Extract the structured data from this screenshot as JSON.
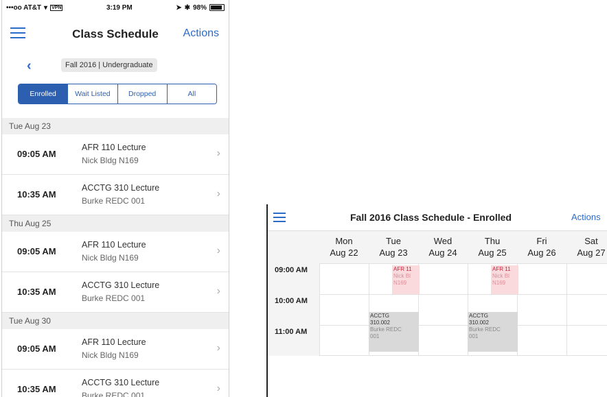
{
  "status_bar": {
    "carrier": "•••oo AT&T",
    "vpn": "VPN",
    "time": "3:19 PM",
    "battery": "98%"
  },
  "header": {
    "title": "Class Schedule",
    "actions_label": "Actions"
  },
  "term": {
    "label": "Fall 2016 | Undergraduate"
  },
  "filter_tabs": [
    {
      "label": "Enrolled",
      "active": true
    },
    {
      "label": "Wait Listed",
      "active": false
    },
    {
      "label": "Dropped",
      "active": false
    },
    {
      "label": "All",
      "active": false
    }
  ],
  "days": [
    {
      "date": "Tue Aug 23",
      "classes": [
        {
          "time": "09:05 AM",
          "name": "AFR 110 Lecture",
          "location": "Nick Bldg N169"
        },
        {
          "time": "10:35 AM",
          "name": "ACCTG 310 Lecture",
          "location": "Burke REDC 001"
        }
      ]
    },
    {
      "date": "Thu Aug 25",
      "classes": [
        {
          "time": "09:05 AM",
          "name": "AFR 110 Lecture",
          "location": "Nick Bldg N169"
        },
        {
          "time": "10:35 AM",
          "name": "ACCTG 310 Lecture",
          "location": "Burke REDC 001"
        }
      ]
    },
    {
      "date": "Tue Aug 30",
      "classes": [
        {
          "time": "09:05 AM",
          "name": "AFR 110 Lecture",
          "location": "Nick Bldg N169"
        },
        {
          "time": "10:35 AM",
          "name": "ACCTG 310 Lecture",
          "location": "Burke REDC 001"
        }
      ]
    }
  ],
  "week_view": {
    "title": "Fall 2016 Class Schedule - Enrolled",
    "actions_label": "Actions",
    "columns": [
      {
        "day": "Mon",
        "date": "Aug 22"
      },
      {
        "day": "Tue",
        "date": "Aug 23"
      },
      {
        "day": "Wed",
        "date": "Aug 24"
      },
      {
        "day": "Thu",
        "date": "Aug 25"
      },
      {
        "day": "Fri",
        "date": "Aug 26"
      },
      {
        "day": "Sat",
        "date": "Aug 27"
      }
    ],
    "times": [
      "09:00 AM",
      "10:00 AM",
      "11:00 AM"
    ],
    "events": [
      {
        "column": "Tue",
        "line1": "AFR 11",
        "line2": "Nick Bl",
        "line3": "N169",
        "color": "#fadadd"
      },
      {
        "column": "Thu",
        "line1": "AFR 11",
        "line2": "Nick Bl",
        "line3": "N169",
        "color": "#fadadd"
      },
      {
        "column": "Tue",
        "line1": "ACCTG",
        "line2": "310.002",
        "line3": "Burke REDC",
        "line4": "001",
        "color": "#d9d9d9"
      },
      {
        "column": "Thu",
        "line1": "ACCTG",
        "line2": "310.002",
        "line3": "Burke REDC",
        "line4": "001",
        "color": "#d9d9d9"
      }
    ]
  },
  "colors": {
    "accent": "#2d6bc9",
    "segment": "#2d5fb0"
  }
}
